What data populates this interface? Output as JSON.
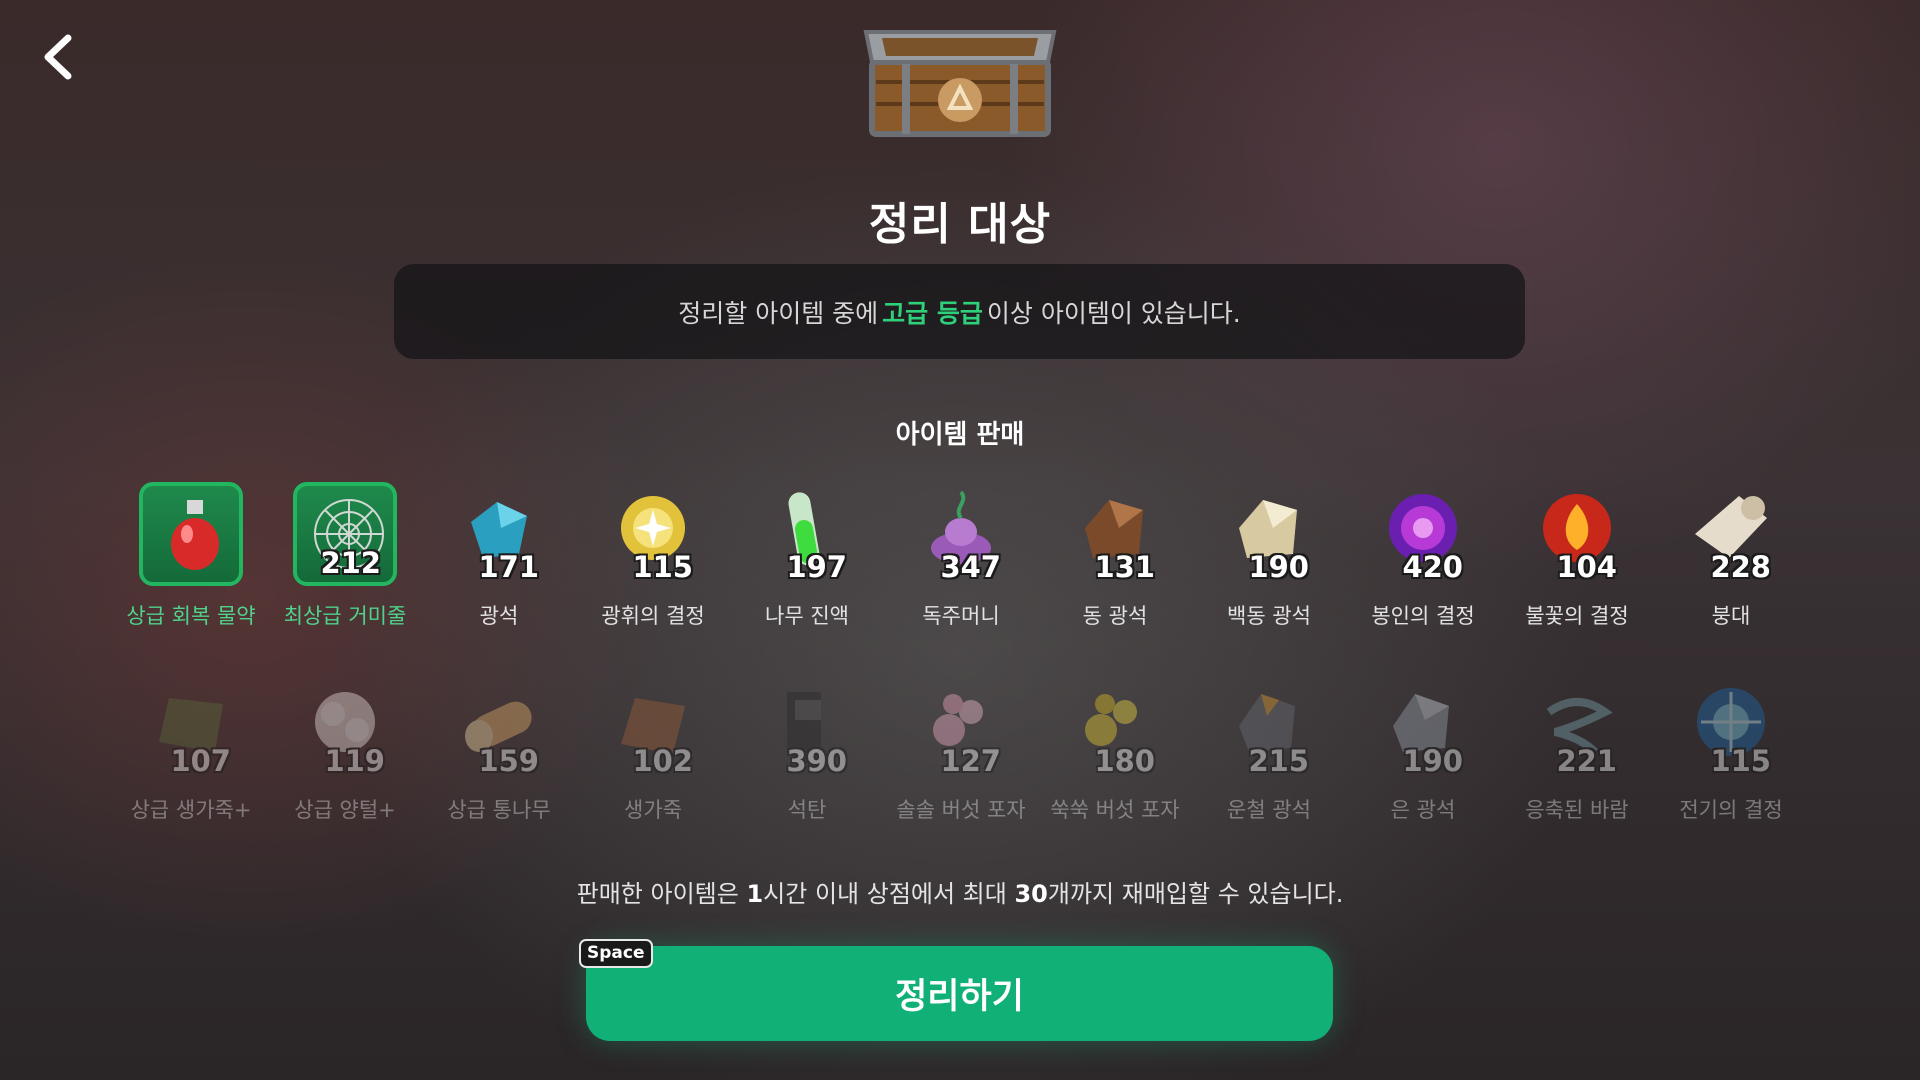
{
  "header": {
    "back_icon": "chevron-left-icon",
    "chest_icon": "recycle-chest-icon"
  },
  "title": "정리 대상",
  "notice": {
    "prefix": "정리할 아이템 중에",
    "highlight": "고급 등급",
    "suffix": "이상 아이템이 있습니다."
  },
  "section_title": "아이템 판매",
  "items_row1": [
    {
      "label": "상급 회복 물약",
      "count": "",
      "selected": true,
      "icon": "red-potion-icon"
    },
    {
      "label": "최상급 거미줄",
      "count": "212",
      "selected": true,
      "icon": "spider-web-icon"
    },
    {
      "label": "광석",
      "count": "171",
      "selected": false,
      "icon": "blue-ore-icon"
    },
    {
      "label": "광휘의 결정",
      "count": "115",
      "selected": false,
      "icon": "radiant-crystal-icon"
    },
    {
      "label": "나무 진액",
      "count": "197",
      "selected": false,
      "icon": "sap-vial-icon"
    },
    {
      "label": "독주머니",
      "count": "347",
      "selected": false,
      "icon": "poison-sac-icon"
    },
    {
      "label": "동 광석",
      "count": "131",
      "selected": false,
      "icon": "copper-ore-icon"
    },
    {
      "label": "백동 광석",
      "count": "190",
      "selected": false,
      "icon": "cupronickel-ore-icon"
    },
    {
      "label": "봉인의 결정",
      "count": "420",
      "selected": false,
      "icon": "seal-crystal-icon"
    },
    {
      "label": "불꽃의 결정",
      "count": "104",
      "selected": false,
      "icon": "flame-crystal-icon"
    },
    {
      "label": "붕대",
      "count": "228",
      "selected": false,
      "icon": "bandage-icon"
    }
  ],
  "items_row2": [
    {
      "label": "상급 생가죽+",
      "count": "107",
      "icon": "green-hide-icon"
    },
    {
      "label": "상급 양털+",
      "count": "119",
      "icon": "wool-icon"
    },
    {
      "label": "상급 통나무",
      "count": "159",
      "icon": "log-icon"
    },
    {
      "label": "생가죽",
      "count": "102",
      "icon": "hide-icon"
    },
    {
      "label": "석탄",
      "count": "390",
      "icon": "coal-icon"
    },
    {
      "label": "솔솔 버섯 포자",
      "count": "127",
      "icon": "pink-spore-icon"
    },
    {
      "label": "쑥쑥 버섯 포자",
      "count": "180",
      "icon": "yellow-spore-icon"
    },
    {
      "label": "운철 광석",
      "count": "215",
      "icon": "meteor-ore-icon"
    },
    {
      "label": "은 광석",
      "count": "190",
      "icon": "silver-ore-icon"
    },
    {
      "label": "응축된 바람",
      "count": "221",
      "icon": "wind-icon"
    },
    {
      "label": "전기의 결정",
      "count": "115",
      "icon": "electric-crystal-icon"
    }
  ],
  "footer": {
    "p1": "판매한 아이템은 ",
    "b1": "1",
    "p2": "시간 이내 상점에서 최대 ",
    "b2": "30",
    "p3": "개까지 재매입할 수 있습니다."
  },
  "action": {
    "key_hint": "Space",
    "button_label": "정리하기"
  },
  "colors": {
    "accent": "#11b076",
    "highlight": "#2fd07a"
  }
}
